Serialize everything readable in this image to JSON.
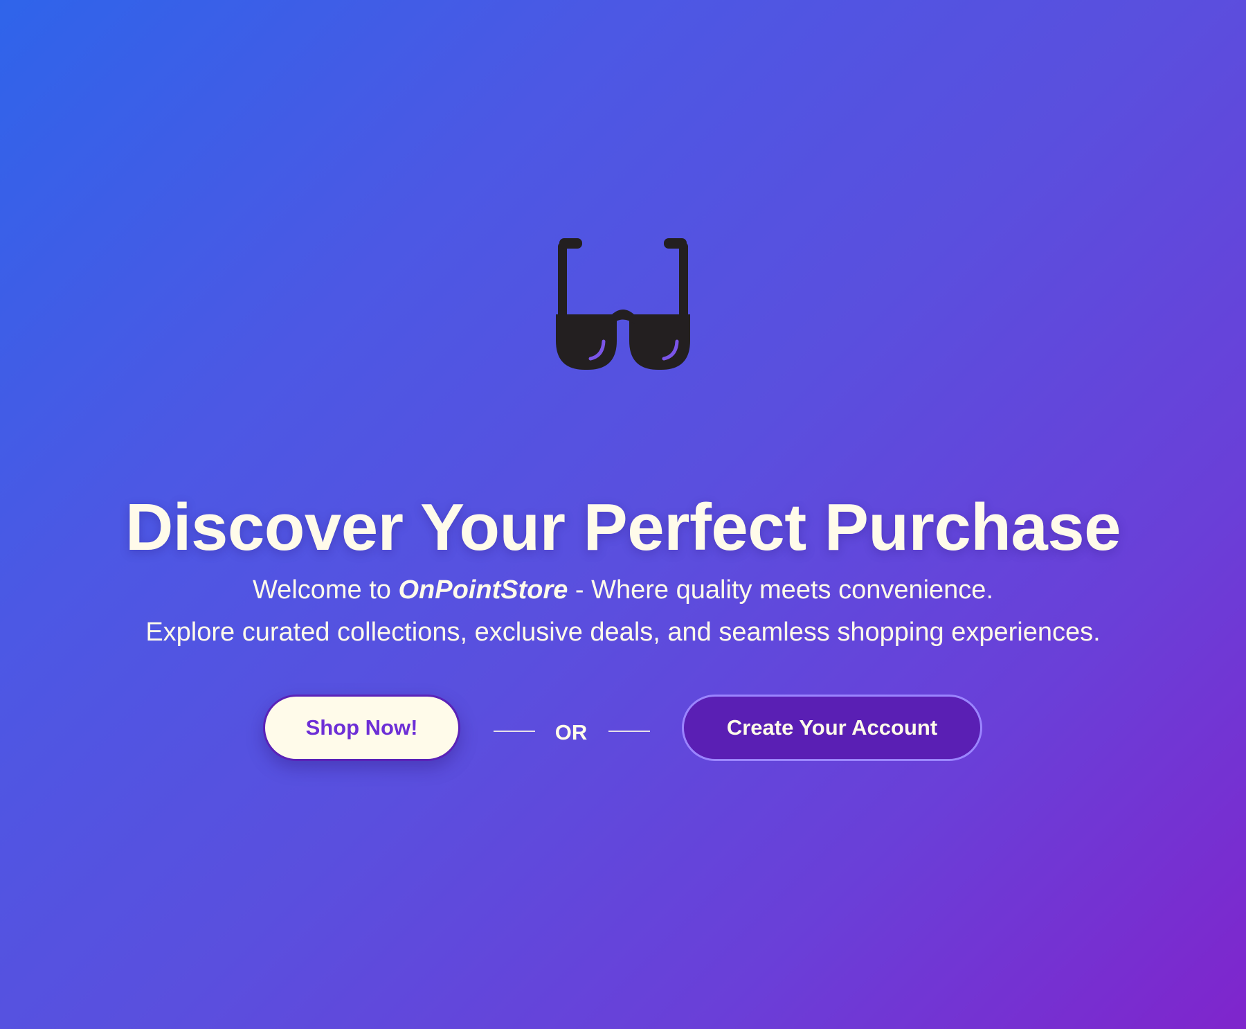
{
  "hero": {
    "icon": "sunglasses-icon",
    "headline": "Discover Your Perfect Purchase",
    "subtitle": {
      "line1_prefix": "Welcome to ",
      "brand": "OnPointStore",
      "line1_suffix": " - Where quality meets convenience.",
      "line2": "Explore curated collections, exclusive deals, and seamless shopping experiences."
    },
    "actions": {
      "primary_label": "Shop Now!",
      "divider_label": "OR",
      "secondary_label": "Create Your Account"
    }
  },
  "colors": {
    "background_start": "#2f64ea",
    "background_end": "#7f25cc",
    "text": "#fffbea",
    "primary_button_bg": "#fffbea",
    "primary_button_text": "#6d2fd6",
    "secondary_button_bg": "#5a1fb4",
    "secondary_button_border": "#9b85ff",
    "icon": "#231f20"
  }
}
